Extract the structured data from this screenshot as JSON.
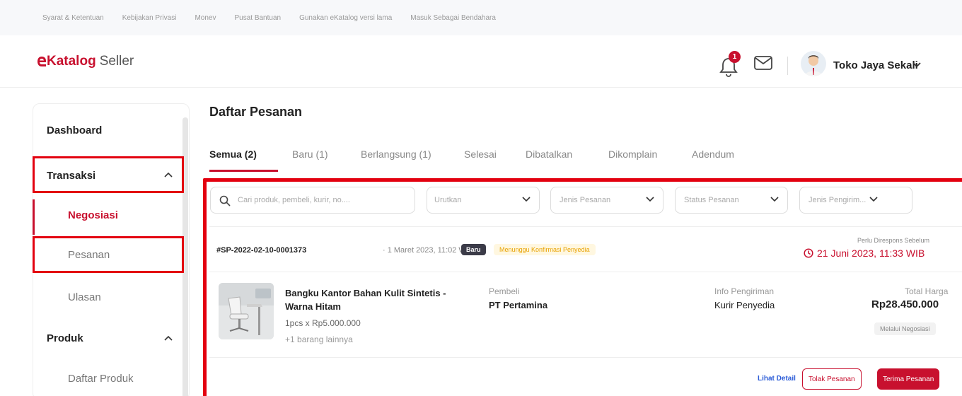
{
  "top_links": [
    "Syarat & Ketentuan",
    "Kebijakan Privasi",
    "Monev",
    "Pusat Bantuan",
    "Gunakan eKatalog versi lama",
    "Masuk Sebagai Bendahara"
  ],
  "header": {
    "logo_main": "Katalog",
    "logo_sub": "Seller",
    "notif_count": "1",
    "store_name": "Toko Jaya Sekali"
  },
  "sidebar": {
    "dashboard": "Dashboard",
    "transaksi": "Transaksi",
    "negosiasi": "Negosiasi",
    "pesanan": "Pesanan",
    "ulasan": "Ulasan",
    "produk": "Produk",
    "daftar_produk": "Daftar Produk"
  },
  "main": {
    "title": "Daftar Pesanan",
    "tabs": [
      "Semua (2)",
      "Baru (1)",
      "Berlangsung (1)",
      "Selesai",
      "Dibatalkan",
      "Dikomplain",
      "Adendum"
    ],
    "filters": {
      "search_placeholder": "Cari produk, pembeli, kurir, no....",
      "sort": "Urutkan",
      "order_type": "Jenis Pesanan",
      "order_status": "Status Pesanan",
      "shipping_type": "Jenis Pengirim..."
    }
  },
  "order": {
    "id": "#SP-2022-02-10-0001373",
    "date": "· 1 Maret 2023, 11:02 WIB ·",
    "badge_new": "Baru",
    "badge_status": "Menunggu Konfirmasi Penyedia",
    "due_label": "Perlu Direspons Sebelum",
    "due_date": "21 Juni 2023, 11:33 WIB",
    "product_name": "Bangku Kantor Bahan Kulit Sintetis - Warna Hitam",
    "qty": "1pcs x Rp5.000.000",
    "more": "+1 barang lainnya",
    "buyer_label": "Pembeli",
    "buyer": "PT Pertamina",
    "shipping_label": "Info Pengiriman",
    "shipping": "Kurir Penyedia",
    "total_label": "Total Harga",
    "total": "Rp28.450.000",
    "via": "Melalui Negosiasi",
    "actions": {
      "detail": "Lihat Detail",
      "reject": "Tolak Pesanan",
      "accept": "Terima Pesanan"
    }
  },
  "colors": {
    "brand": "#c8102e",
    "highlight": "#e3000f",
    "link": "#2a5bd7"
  }
}
